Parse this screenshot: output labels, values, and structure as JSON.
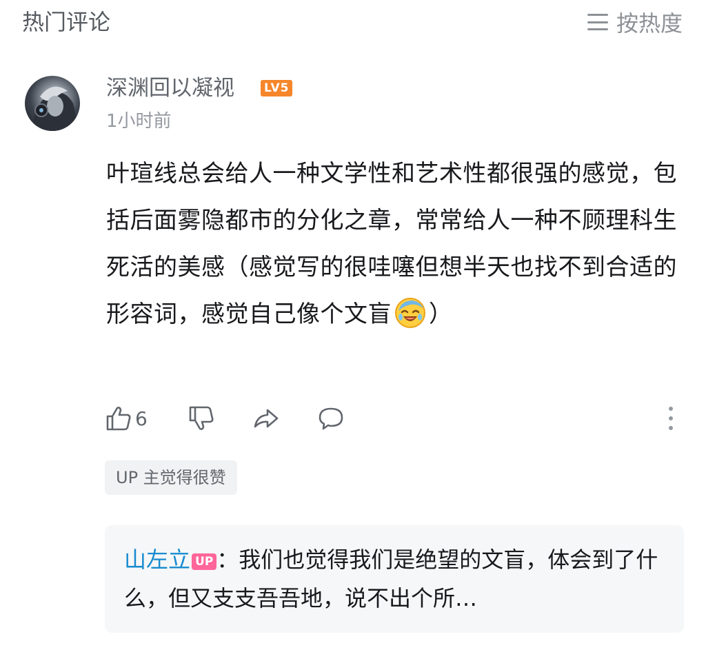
{
  "header": {
    "title": "热门评论",
    "sort_label": "按热度"
  },
  "comment": {
    "username": "深渊回以凝视",
    "level": "LV5",
    "timestamp": "1小时前",
    "text_main": "叶瑄线总会给人一种文学性和艺术性都很强的感觉，包括后面雾隐都市的分化之章，常常给人一种不顾理科生死活的美感（感觉写的很哇噻但想半天也找不到合适的形容词，感觉自己像个文盲",
    "text_end": "）",
    "emoji_name": "laugh-cry-face-emoji",
    "like_count": "6"
  },
  "up_tag": "UP 主觉得很赞",
  "reply": {
    "author": "山左立",
    "badge": "UP",
    "separator": "：",
    "text": "我们也觉得我们是绝望的文盲，体会到了什么，但又支支吾吾地，说不出个所…"
  },
  "colors": {
    "accent_blue": "#178bcf",
    "level_orange": "#f5862a",
    "up_pink": "#ff6699",
    "text_gray": "#61666d"
  }
}
